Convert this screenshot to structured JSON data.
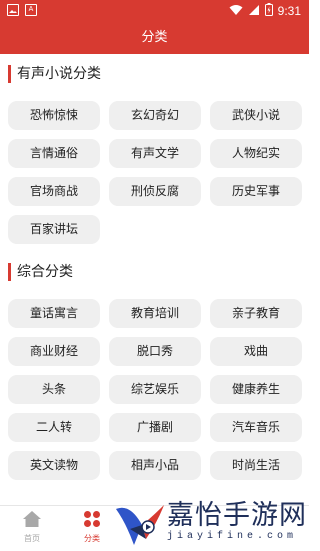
{
  "status_bar": {
    "time": "9:31",
    "left_icons": [
      "image-icon",
      "text-a-icon"
    ],
    "right_icons": [
      "wifi-icon",
      "signal-icon",
      "battery-icon"
    ]
  },
  "header": {
    "title": "分类"
  },
  "sections": [
    {
      "title": "有声小说分类",
      "items": [
        "恐怖惊悚",
        "玄幻奇幻",
        "武侠小说",
        "言情通俗",
        "有声文学",
        "人物纪实",
        "官场商战",
        "刑侦反腐",
        "历史军事",
        "百家讲坛"
      ]
    },
    {
      "title": "综合分类",
      "items": [
        "童话寓言",
        "教育培训",
        "亲子教育",
        "商业财经",
        "脱口秀",
        "戏曲",
        "头条",
        "综艺娱乐",
        "健康养生",
        "二人转",
        "广播剧",
        "汽车音乐",
        "英文读物",
        "相声小品",
        "时尚生活"
      ]
    }
  ],
  "bottom_nav": {
    "items": [
      {
        "label": "首页",
        "icon": "home-icon"
      },
      {
        "label": "分类",
        "icon": "category-grid-icon"
      }
    ]
  },
  "watermark": {
    "title": "嘉怡手游网",
    "subtitle": "jiayifine.com"
  },
  "colors": {
    "accent": "#d73a31",
    "chip_bg": "#efefef",
    "text": "#222222"
  }
}
